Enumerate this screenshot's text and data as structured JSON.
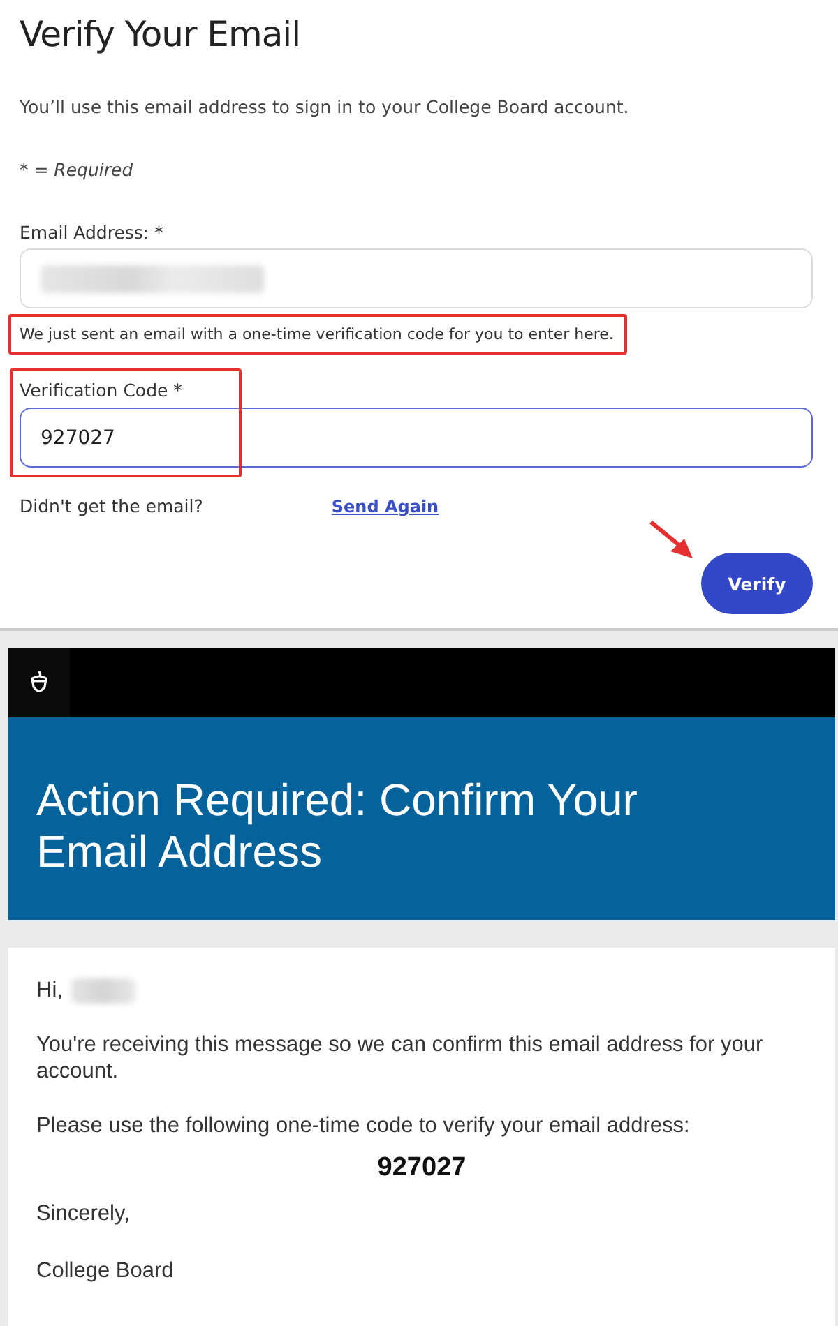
{
  "form": {
    "title": "Verify Your Email",
    "description": "You’ll use this email address to sign in to your College Board account.",
    "required_note": "* = Required",
    "email_field": {
      "label": "Email Address: *",
      "redacted": true
    },
    "notice": {
      "text": "We just sent an email with a one-time verification code for you to enter here.",
      "highlighted": true
    },
    "code_field": {
      "label": "Verification Code *",
      "value": "927027",
      "focused": true,
      "highlighted": true
    },
    "resend": {
      "text": "Didn't get the email?",
      "link": "Send Again"
    },
    "verify_button": {
      "label": "Verify",
      "pointed": true
    }
  },
  "email": {
    "heading": "Action Required: Confirm Your Email Address",
    "greeting": "Hi,",
    "name_redacted": true,
    "paragraphs": [
      "You're receiving this message so we can confirm this email address for your account.",
      "Please use the following one-time code to verify your email address:"
    ],
    "code": "927027",
    "closing": [
      "Sincerely,",
      "College Board"
    ]
  }
}
